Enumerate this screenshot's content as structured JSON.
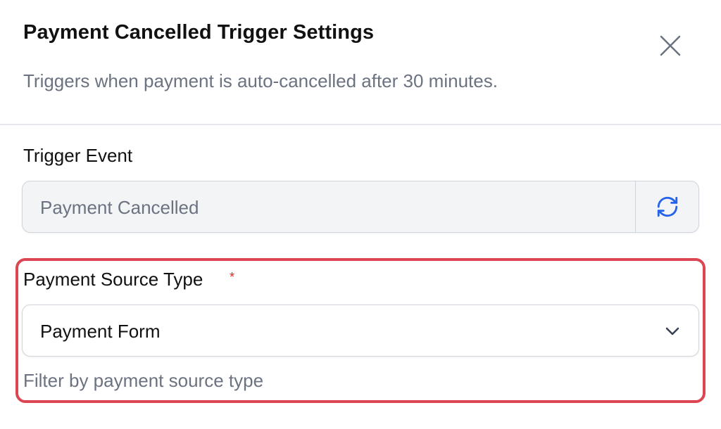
{
  "dialog": {
    "title": "Payment Cancelled Trigger Settings",
    "subtitle": "Triggers when payment is auto-cancelled after 30 minutes.",
    "close_icon": "close-icon"
  },
  "trigger_event": {
    "label": "Trigger Event",
    "value": "Payment Cancelled",
    "refresh_icon": "refresh-icon"
  },
  "payment_source": {
    "label": "Payment Source Type",
    "required_marker": "*",
    "selected": "Payment Form",
    "help_text": "Filter by payment source type",
    "chevron_icon": "chevron-down-icon"
  },
  "colors": {
    "highlight": "#dc4552",
    "accent": "#2563eb",
    "required": "#dc2626"
  }
}
